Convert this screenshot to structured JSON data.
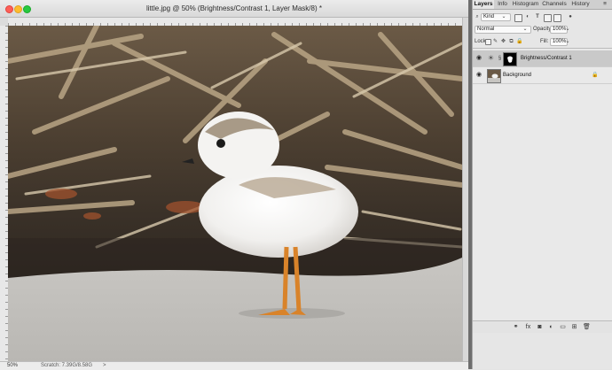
{
  "document": {
    "title": "little.jpg @ 50% (Brightness/Contrast 1, Layer Mask/8) *",
    "zoom": "50%",
    "scratch": "Scratch: 7.39G/8.58G",
    "status_arrow": ">"
  },
  "panel": {
    "tabs": [
      "Layers",
      "Info",
      "Histogram",
      "Channels",
      "History"
    ],
    "active_tab": "Layers",
    "filter": {
      "label": "Kind",
      "icons": [
        "image-filter-icon",
        "adjustment-filter-icon",
        "type-filter-icon",
        "shape-filter-icon",
        "smart-object-filter-icon"
      ]
    },
    "blend_mode": "Normal",
    "opacity_label": "Opacity:",
    "opacity_value": "100%",
    "lock_label": "Lock:",
    "fill_label": "Fill:",
    "fill_value": "100%",
    "layers": [
      {
        "name": "Brightness/Contrast 1",
        "visible": true,
        "selected": true,
        "type": "adjustment"
      },
      {
        "name": "Background",
        "visible": true,
        "selected": false,
        "type": "image",
        "locked": true
      }
    ]
  },
  "colors": {
    "accent_selected": "#c9c9c9",
    "close": "#fe5f57",
    "minimize": "#febc2e",
    "maximize": "#28c840"
  }
}
